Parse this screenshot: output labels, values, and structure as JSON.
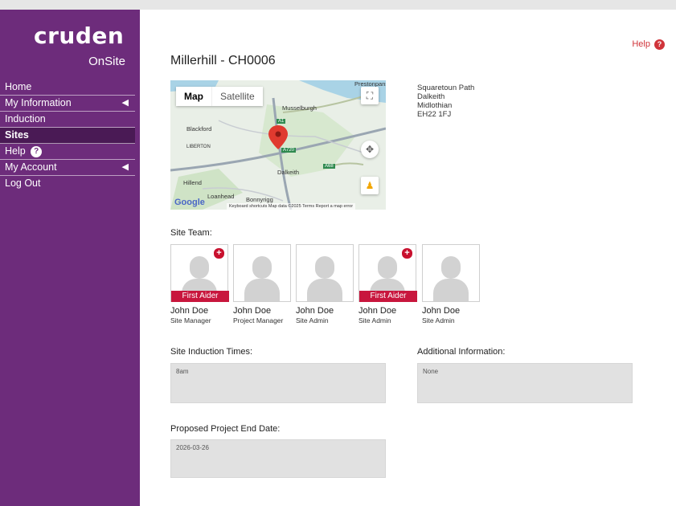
{
  "brand": {
    "logo_text": "cruden",
    "sub_text": "OnSite"
  },
  "sidebar": {
    "items": [
      {
        "label": "Home"
      },
      {
        "label": "My Information",
        "arrow": "◀"
      },
      {
        "label": "Induction"
      },
      {
        "label": "Sites"
      },
      {
        "label": "Help",
        "icon": "?"
      },
      {
        "label": "My Account",
        "arrow": "◀"
      },
      {
        "label": "Log Out"
      }
    ],
    "active": "Sites"
  },
  "header": {
    "help_label": "Help",
    "help_icon": "?"
  },
  "page": {
    "title": "Millerhill - CH0006"
  },
  "map": {
    "tab_map": "Map",
    "tab_satellite": "Satellite",
    "labels": {
      "prestonpans": "Prestonpans",
      "musselburgh": "Musselburgh",
      "blackford": "Blackford",
      "liberton": "LIBERTON",
      "dalkeith": "Dalkeith",
      "hillend": "Hillend",
      "loanhead": "Loanhead",
      "bonnyrigg": "Bonnyrigg",
      "a1": "A1",
      "a720": "A720",
      "a68": "A68"
    },
    "footer": "Keyboard shortcuts   Map data ©2025   Terms   Report a map error",
    "google": "Google"
  },
  "address": {
    "line1": "Squaretoun Path",
    "line2": "Dalkeith",
    "line3": "Midlothian",
    "line4": "EH22 1FJ"
  },
  "team": {
    "label": "Site Team:",
    "first_aider_label": "First Aider",
    "members": [
      {
        "name": "John Doe",
        "role": "Site Manager",
        "first_aider": true
      },
      {
        "name": "John Doe",
        "role": "Project Manager",
        "first_aider": false
      },
      {
        "name": "John Doe",
        "role": "Site Admin",
        "first_aider": false
      },
      {
        "name": "John Doe",
        "role": "Site Admin",
        "first_aider": true
      },
      {
        "name": "John Doe",
        "role": "Site Admin",
        "first_aider": false
      }
    ]
  },
  "induction": {
    "label": "Site Induction Times:",
    "value": "8am"
  },
  "additional": {
    "label": "Additional Information:",
    "value": "None"
  },
  "end_date": {
    "label": "Proposed Project End Date:",
    "value": "2026-03-26"
  },
  "colors": {
    "sidebar": "#6d2c7b",
    "active_nav": "#4a1a55",
    "first_aider": "#c8163d",
    "help": "#d0343a"
  }
}
